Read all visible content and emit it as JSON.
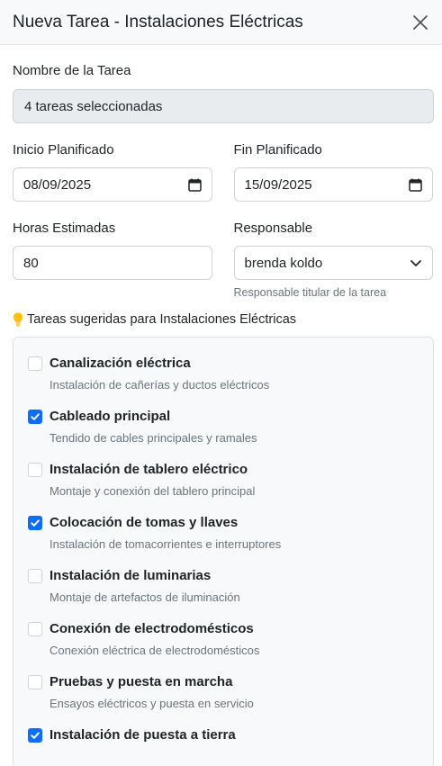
{
  "header": {
    "title": "Nueva Tarea - Instalaciones Eléctricas"
  },
  "task_name": {
    "label": "Nombre de la Tarea",
    "value": "4 tareas seleccionadas"
  },
  "start": {
    "label": "Inicio Planificado",
    "value": "08/09/2025"
  },
  "end": {
    "label": "Fin Planificado",
    "value": "15/09/2025"
  },
  "hours": {
    "label": "Horas Estimadas",
    "value": "80"
  },
  "responsible": {
    "label": "Responsable",
    "value": "brenda koldo",
    "help": "Responsable titular de la tarea"
  },
  "suggested": {
    "title": "Tareas sugeridas para Instalaciones Eléctricas",
    "items": [
      {
        "title": "Canalización eléctrica",
        "desc": "Instalación de cañerías y ductos eléctricos",
        "checked": false
      },
      {
        "title": "Cableado principal",
        "desc": "Tendido de cables principales y ramales",
        "checked": true
      },
      {
        "title": "Instalación de tablero eléctrico",
        "desc": "Montaje y conexión del tablero principal",
        "checked": false
      },
      {
        "title": "Colocación de tomas y llaves",
        "desc": "Instalación de tomacorrientes e interruptores",
        "checked": true
      },
      {
        "title": "Instalación de luminarias",
        "desc": "Montaje de artefactos de iluminación",
        "checked": false
      },
      {
        "title": "Conexión de electrodomésticos",
        "desc": "Conexión eléctrica de electrodomésticos",
        "checked": false
      },
      {
        "title": "Pruebas y puesta en marcha",
        "desc": "Ensayos eléctricos y puesta en servicio",
        "checked": false
      },
      {
        "title": "Instalación de puesta a tierra",
        "desc": "",
        "checked": true
      }
    ]
  },
  "colors": {
    "accent": "#0d6efd",
    "bulb": "#ffc107"
  }
}
